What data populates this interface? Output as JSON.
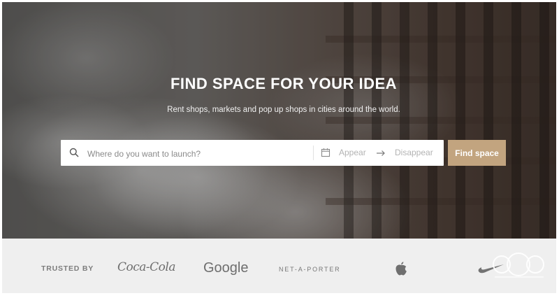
{
  "hero": {
    "title": "FIND SPACE FOR YOUR IDEA",
    "subtitle": "Rent shops, markets and pop up shops in cities around the world."
  },
  "search": {
    "placeholder": "Where do you want to launch?",
    "appear_label": "Appear",
    "disappear_label": "Disappear",
    "button_label": "Find space"
  },
  "trusted": {
    "label": "TRUSTED BY",
    "logos": [
      "Coca-Cola",
      "Google",
      "NET-A-PORTER",
      "Apple",
      "Nike"
    ]
  },
  "colors": {
    "accent": "#c2a47f"
  }
}
